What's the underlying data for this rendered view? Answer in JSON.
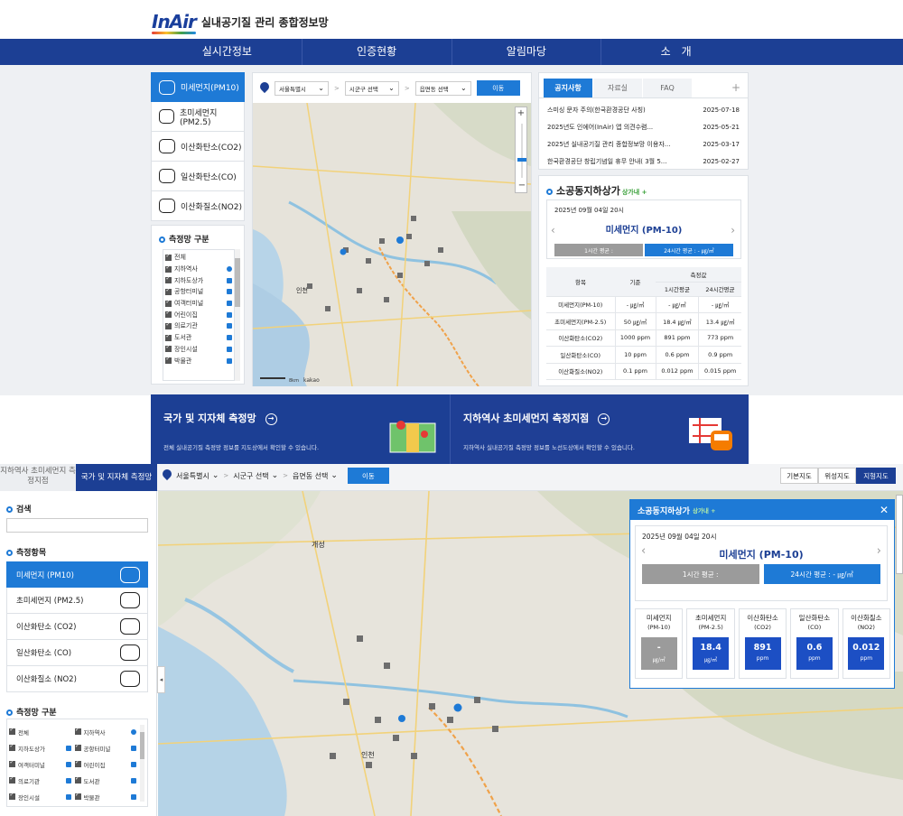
{
  "header": {
    "logo": "InAir",
    "site_title": "실내공기질 관리 종합정보망"
  },
  "nav": [
    "실시간정보",
    "인증현황",
    "알림마당",
    "소　개"
  ],
  "measure_items": [
    {
      "label": "미세먼지(PM10)",
      "icon": "dust-cloud-icon"
    },
    {
      "label": "초미세먼지(PM2.5)",
      "icon": "fine-dust-icon"
    },
    {
      "label": "이산화탄소(CO2)",
      "icon": "factory-leaf-icon"
    },
    {
      "label": "일산화탄소(CO)",
      "icon": "chimney-icon"
    },
    {
      "label": "이산화질소(NO2)",
      "icon": "meter-icon"
    }
  ],
  "group_title": "측정망 구분",
  "groups": [
    "전체",
    "지하역사",
    "지하도상가",
    "공항터미널",
    "여객터미널",
    "어린이집",
    "의료기관",
    "도서관",
    "장인시설",
    "박물관"
  ],
  "map_toolbar": {
    "sido": "서울특별시",
    "sigungu": "시군구 선택",
    "emd": "읍면동 선택",
    "go": "이동"
  },
  "map_labels": {
    "scale": "8km",
    "provider": "kakao",
    "incheon": "인천",
    "kaesong": "개성"
  },
  "notice": {
    "tabs": [
      "공지사항",
      "자료실",
      "FAQ"
    ],
    "plus": "+",
    "rows": [
      {
        "title": "스미싱 문자 주의(한국환경공단 사칭)",
        "date": "2025-07-18"
      },
      {
        "title": "2025년도 인에어(InAir) 앱 의견수렴...",
        "date": "2025-05-21"
      },
      {
        "title": "2025년 실내공기질 관리 종합정보망 이용자...",
        "date": "2025-03-17"
      },
      {
        "title": "한국환경공단 창립기념일 휴무 안내( 3월 5...",
        "date": "2025-02-27"
      }
    ]
  },
  "station": {
    "name": "소공동지하상가",
    "tag": "상가내 +",
    "datetime": "2025년 09월 04일 20시",
    "item": "미세먼지 (PM-10)",
    "avg1": "1시간 평균 :",
    "avg24": "24시간 평균 : - ㎍/㎥",
    "table_head": {
      "item": "항목",
      "standard": "기준",
      "measured": "측정값",
      "h1": "1시간평균",
      "h24": "24시간평균"
    },
    "table_rows": [
      {
        "name": "미세먼지(PM-10)",
        "std": "- ㎍/㎥",
        "h1": "- ㎍/㎥",
        "h24": "- ㎍/㎥"
      },
      {
        "name": "초미세먼지(PM-2.5)",
        "std": "50 ㎍/㎥",
        "h1": "18.4 ㎍/㎥",
        "h24": "13.4 ㎍/㎥"
      },
      {
        "name": "이산화탄소(CO2)",
        "std": "1000 ppm",
        "h1": "891 ppm",
        "h24": "773 ppm"
      },
      {
        "name": "일산화탄소(CO)",
        "std": "10 ppm",
        "h1": "0.6 ppm",
        "h24": "0.9 ppm"
      },
      {
        "name": "이산화질소(NO2)",
        "std": "0.1 ppm",
        "h1": "0.012 ppm",
        "h24": "0.015 ppm"
      }
    ]
  },
  "banners": [
    {
      "title": "국가 및 지자체 측정망",
      "desc": "전체 실내공기질 측정망 정보를 지도상에서 확인할 수 있습니다."
    },
    {
      "title": "지하역사 초미세먼지 측정지점",
      "desc": "지하역사 실내공기질 측정망 정보를 노선도상에서 확인할 수 있습니다."
    }
  ],
  "lower": {
    "tab1": "지하역사 초미세먼지 측정지점",
    "tab2": "국가 및 지자체 측정망",
    "sido": "서울특별시",
    "sigungu": "시군구 선택",
    "emd": "읍면동 선택",
    "go": "이동",
    "map_types": [
      "기본지도",
      "위성지도",
      "지형지도"
    ],
    "search_title": "검색",
    "items_title": "측정항목",
    "items": [
      "미세먼지 (PM10)",
      "초미세먼지 (PM2.5)",
      "이산화탄소 (CO2)",
      "일산화탄소 (CO)",
      "이산화질소 (NO2)"
    ],
    "group_title": "측정망 구분",
    "groups": [
      "전체",
      "지하역사",
      "지하도상가",
      "공항터미널",
      "여객터미널",
      "어린이집",
      "의료기관",
      "도서관",
      "장인시설",
      "박물관"
    ]
  },
  "popup": {
    "name": "소공동지하상가",
    "tag": "상가내 +",
    "close": "✕",
    "datetime": "2025년 09월 04일 20시",
    "item": "미세먼지 (PM-10)",
    "avg1": "1시간 평균 :",
    "avg24": "24시간 평균 : - ㎍/㎥",
    "boxes": [
      {
        "n1": "미세먼지",
        "n2": "(PM-10)",
        "value": "-",
        "unit": "㎍/㎥",
        "grey": true
      },
      {
        "n1": "초미세먼지",
        "n2": "(PM-2.5)",
        "value": "18.4",
        "unit": "㎍/㎥",
        "grey": false
      },
      {
        "n1": "이산화탄소",
        "n2": "(CO2)",
        "value": "891",
        "unit": "ppm",
        "grey": false
      },
      {
        "n1": "일산화탄소",
        "n2": "(CO)",
        "value": "0.6",
        "unit": "ppm",
        "grey": false
      },
      {
        "n1": "이산화질소",
        "n2": "(NO2)",
        "value": "0.012",
        "unit": "ppm",
        "grey": false
      }
    ]
  },
  "colors": {
    "navy": "#1c3f94",
    "blue": "#1e7ad6",
    "grey": "#9b9b9b"
  }
}
